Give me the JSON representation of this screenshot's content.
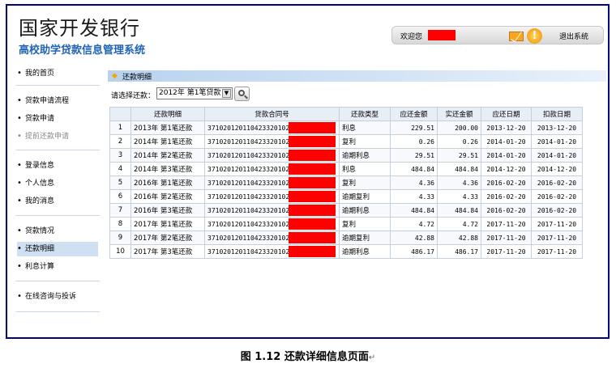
{
  "header": {
    "title": "国家开发银行",
    "subtitle": "高校助学贷款信息管理系统",
    "welcome": "欢迎您",
    "logout": "退出系统",
    "icons": [
      "mail-icon",
      "alert-icon"
    ]
  },
  "sidebar": {
    "items": [
      {
        "label": "我的首页",
        "state": "normal"
      },
      {
        "label": "贷款申请流程",
        "state": "normal"
      },
      {
        "label": "贷款申请",
        "state": "normal"
      },
      {
        "label": "提前还款申请",
        "state": "disabled"
      },
      {
        "label": "登录信息",
        "state": "normal"
      },
      {
        "label": "个人信息",
        "state": "normal"
      },
      {
        "label": "我的消息",
        "state": "normal"
      },
      {
        "label": "贷款情况",
        "state": "normal"
      },
      {
        "label": "还款明细",
        "state": "active"
      },
      {
        "label": "利息计算",
        "state": "normal"
      },
      {
        "label": "在线咨询与投诉",
        "state": "normal"
      }
    ]
  },
  "main": {
    "section_title": "还款明细",
    "select_label": "请选择还款：",
    "select_value": "2012年 第1笔贷款",
    "table": {
      "headers": [
        "",
        "还款明细",
        "贷款合同号",
        "还款类型",
        "应还金额",
        "实还金额",
        "应还日期",
        "扣款日期"
      ],
      "rows": [
        [
          "1",
          "2013年 第1笔还款",
          "371020120110423320102",
          "利息",
          "229.51",
          "200.00",
          "2013-12-20",
          "2013-12-20"
        ],
        [
          "2",
          "2014年 第1笔还款",
          "371020120110423320102",
          "复利",
          "0.26",
          "0.26",
          "2014-01-20",
          "2014-01-20"
        ],
        [
          "3",
          "2014年 第2笔还款",
          "371020120110423320102",
          "逾期利息",
          "29.51",
          "29.51",
          "2014-01-20",
          "2014-01-20"
        ],
        [
          "4",
          "2014年 第3笔还款",
          "371020120110423320102",
          "利息",
          "484.84",
          "484.84",
          "2014-12-20",
          "2014-12-20"
        ],
        [
          "5",
          "2016年 第1笔还款",
          "371020120110423320102",
          "复利",
          "4.36",
          "4.36",
          "2016-02-20",
          "2016-02-20"
        ],
        [
          "6",
          "2016年 第2笔还款",
          "371020120110423320102",
          "逾期复利",
          "4.33",
          "4.33",
          "2016-02-20",
          "2016-02-20"
        ],
        [
          "7",
          "2016年 第3笔还款",
          "371020120110423320102",
          "逾期利息",
          "484.84",
          "484.84",
          "2016-02-20",
          "2016-02-20"
        ],
        [
          "8",
          "2017年 第1笔还款",
          "371020120110423320102",
          "复利",
          "4.72",
          "4.72",
          "2017-11-20",
          "2017-11-20"
        ],
        [
          "9",
          "2017年 第2笔还款",
          "371020120110423320102",
          "逾期复利",
          "42.88",
          "42.88",
          "2017-11-20",
          "2017-11-20"
        ],
        [
          "10",
          "2017年 第3笔还款",
          "371020120110423320102",
          "逾期利息",
          "486.17",
          "486.17",
          "2017-11-20",
          "2017-11-20"
        ]
      ]
    }
  },
  "caption": {
    "text": "图 1.12 还款详细信息页面",
    "mark": "↵"
  },
  "colors": {
    "frame_border": "#000080",
    "subtitle": "#1f63b5",
    "redaction": "#ff0000",
    "section_bar": "#b8d2ee",
    "active_nav": "#cfe0f3"
  }
}
